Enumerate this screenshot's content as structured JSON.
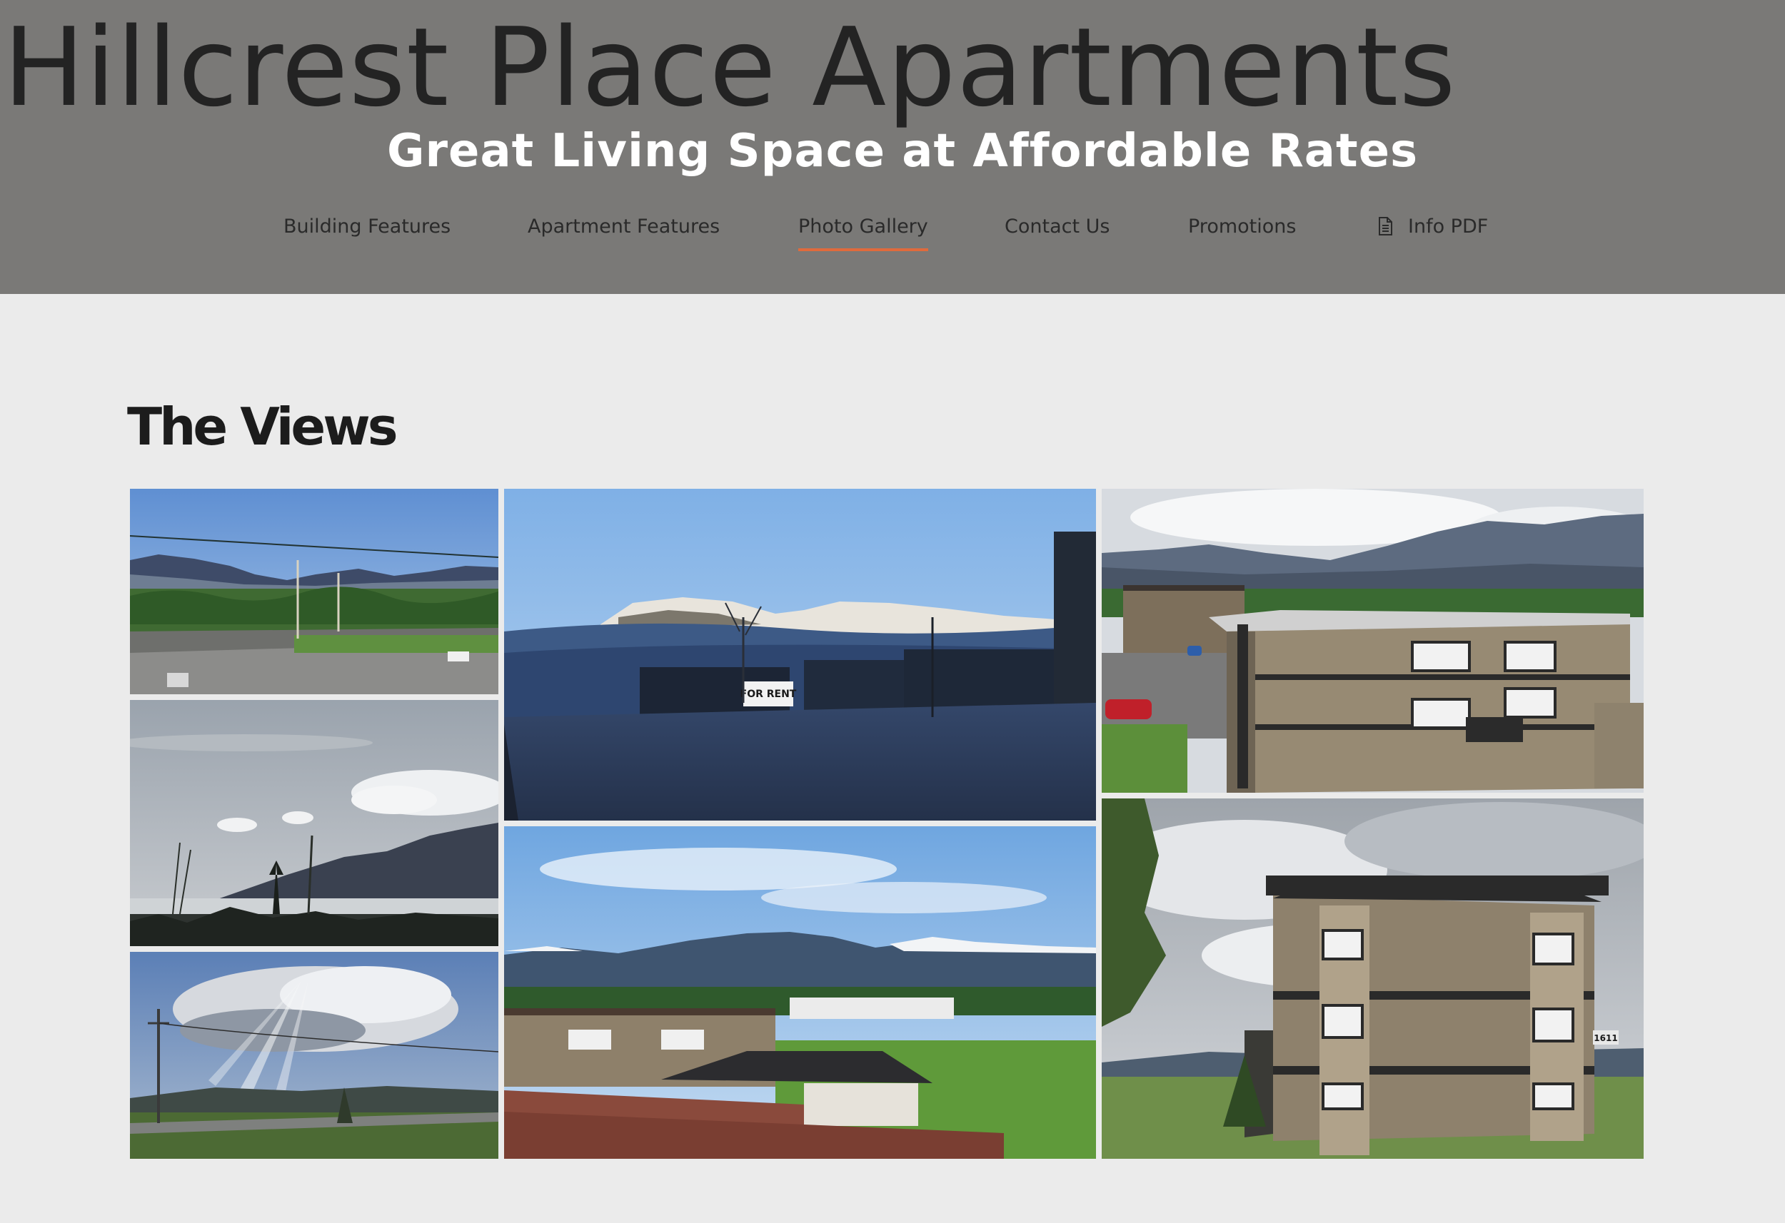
{
  "header": {
    "site_title": "Hillcrest Place Apartments",
    "tagline": "Great Living Space at Affordable Rates",
    "background_color": "#7a7977"
  },
  "nav": {
    "items": [
      {
        "label": "Building Features",
        "active": false
      },
      {
        "label": "Apartment Features",
        "active": false
      },
      {
        "label": "Photo Gallery",
        "active": true
      },
      {
        "label": "Contact Us",
        "active": false
      },
      {
        "label": "Promotions",
        "active": false
      },
      {
        "label": "Info PDF",
        "active": false,
        "icon": "document-icon"
      }
    ],
    "active_underline_color": "#e06a3c"
  },
  "main": {
    "section_title": "The Views",
    "photos": [
      {
        "subject": "mountain-valley-road-view"
      },
      {
        "subject": "cloudy-sky-mountain-lake-view"
      },
      {
        "subject": "sun-rays-through-clouds-view"
      },
      {
        "subject": "morning-fog-mountains-view"
      },
      {
        "subject": "mountains-over-rooftops-view"
      },
      {
        "subject": "aerial-apartment-building-view"
      },
      {
        "subject": "apartment-building-exterior-view"
      }
    ],
    "building_number": "1611",
    "sign_text": "FOR RENT"
  }
}
